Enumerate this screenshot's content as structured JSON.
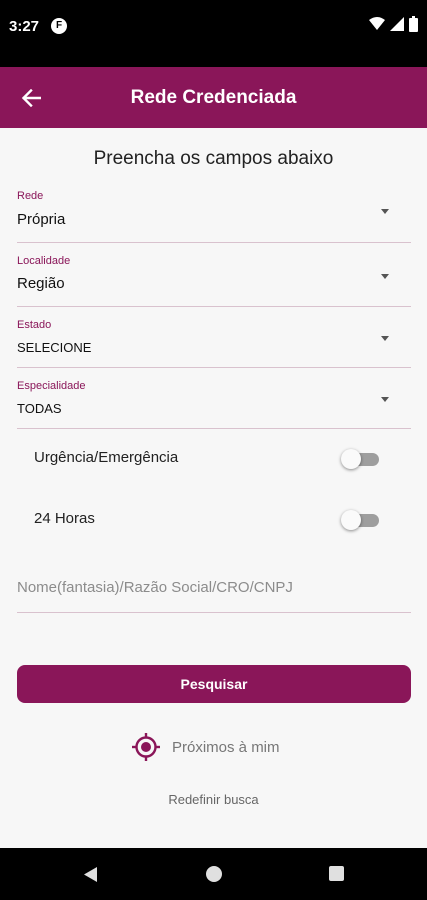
{
  "status_bar": {
    "time": "3:27",
    "app_icon_letter": "F",
    "icons": [
      "wifi-icon",
      "signal-icon",
      "battery-icon"
    ]
  },
  "app_bar": {
    "title": "Rede Credenciada",
    "back_icon": "arrow-left-icon"
  },
  "form": {
    "heading": "Preencha os campos abaixo",
    "fields": [
      {
        "label": "Rede",
        "value": "Própria"
      },
      {
        "label": "Localidade",
        "value": "Região"
      },
      {
        "label": "Estado",
        "value": "SELECIONE"
      },
      {
        "label": "Especialidade",
        "value": "TODAS"
      }
    ],
    "toggles": [
      {
        "label": "Urgência/Emergência",
        "on": false
      },
      {
        "label": "24 Horas",
        "on": false
      }
    ],
    "search": {
      "placeholder": "Nome(fantasia)/Razão Social/CRO/CNPJ",
      "value": ""
    },
    "search_button": "Pesquisar",
    "nearby": {
      "label": "Próximos à mim",
      "icon": "location-target-icon"
    },
    "reset": "Redefinir busca"
  },
  "colors": {
    "primary": "#8a1659",
    "label": "#8a1659",
    "switch_off_track": "#9e9e9e"
  },
  "nav_bar": {
    "icons": [
      "back-triangle-icon",
      "home-circle-icon",
      "recents-square-icon"
    ]
  }
}
